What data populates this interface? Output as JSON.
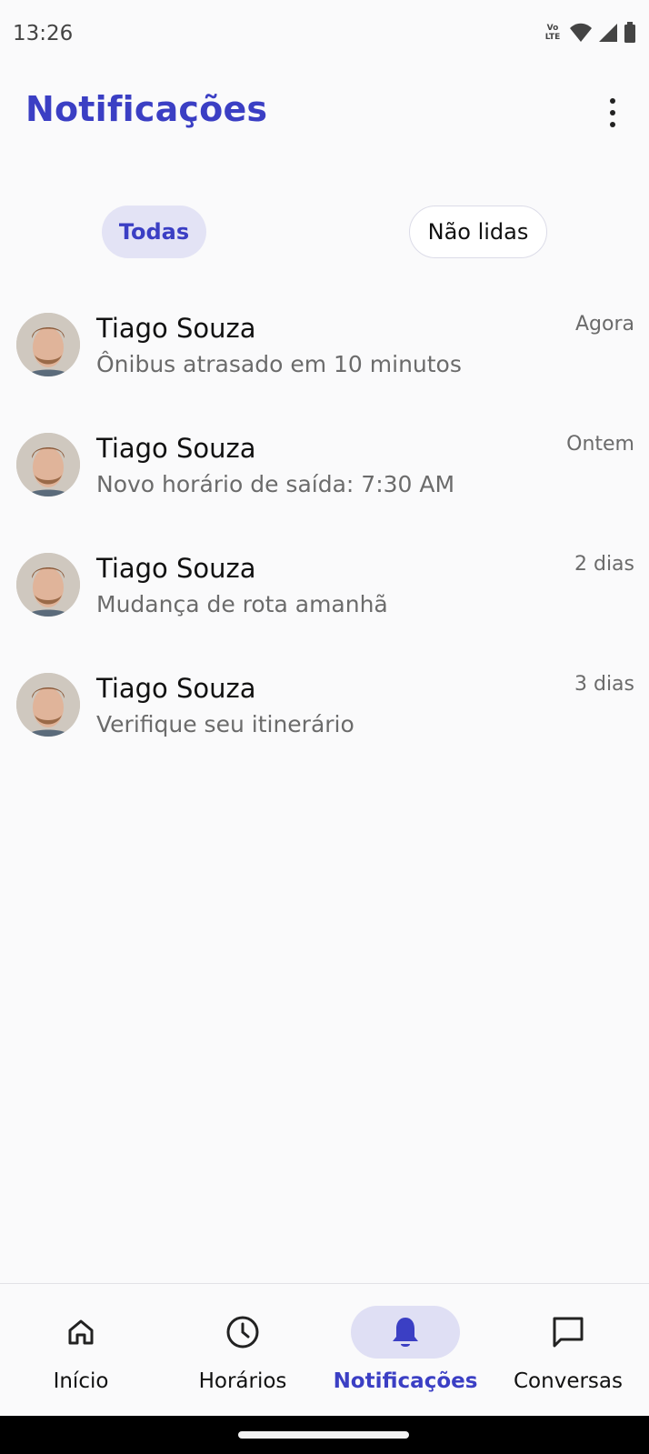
{
  "status_bar": {
    "time": "13:26",
    "volte_line1": "Vo",
    "volte_line2": "LTE",
    "icons": [
      "volte-icon",
      "wifi-icon",
      "signal-icon",
      "battery-icon"
    ]
  },
  "header": {
    "title": "Notificações",
    "more_icon": "more-vert-icon"
  },
  "filters": {
    "all": "Todas",
    "unread": "Não lidas",
    "selected": "Todas"
  },
  "notifications": [
    {
      "sender": "Tiago Souza",
      "message": "Ônibus atrasado em 10 minutos",
      "time": "Agora"
    },
    {
      "sender": "Tiago Souza",
      "message": "Novo horário de saída: 7:30 AM",
      "time": "Ontem"
    },
    {
      "sender": "Tiago Souza",
      "message": "Mudança de rota amanhã",
      "time": "2 dias"
    },
    {
      "sender": "Tiago Souza",
      "message": "Verifique seu itinerário",
      "time": "3 dias"
    }
  ],
  "bottom_nav": [
    {
      "label": "Início",
      "icon": "home-icon",
      "active": false
    },
    {
      "label": "Horários",
      "icon": "clock-icon",
      "active": false
    },
    {
      "label": "Notificações",
      "icon": "bell-icon",
      "active": true
    },
    {
      "label": "Conversas",
      "icon": "chat-icon",
      "active": false
    }
  ],
  "colors": {
    "accent": "#3b3fc4",
    "accent_bg": "#e3e3f5",
    "background": "#fafafb",
    "muted_text": "#6b6b6b"
  }
}
